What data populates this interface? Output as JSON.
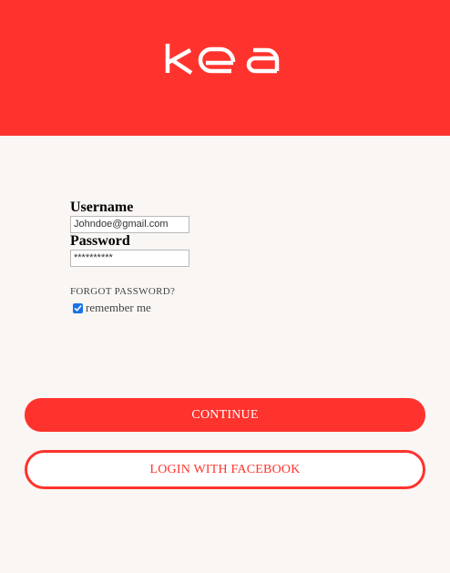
{
  "brand": {
    "logo_text": "kea",
    "accent_color": "#ff332d",
    "background_color": "#faf6f4"
  },
  "form": {
    "username_label": "Username",
    "username_value": "Johndoe@gmail.com",
    "password_label": "Password",
    "password_value": "**********",
    "forgot_password": "FORGOT PASSWORD?",
    "remember_me": "remember me",
    "remember_me_checked": true
  },
  "actions": {
    "continue_label": "CONTINUE",
    "facebook_label": "LOGIN WITH FACEBOOK"
  }
}
